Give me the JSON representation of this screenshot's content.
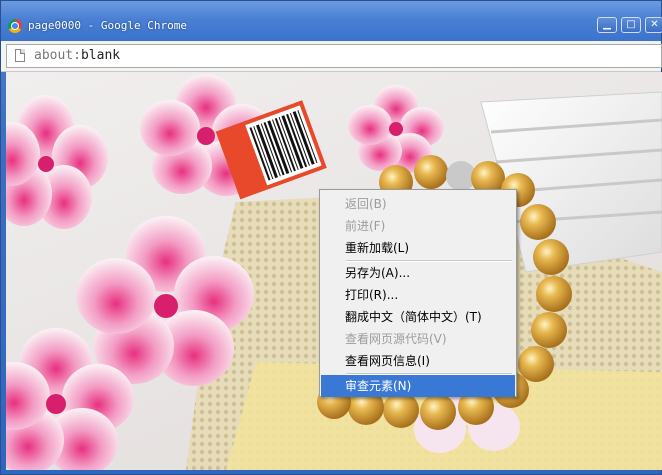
{
  "window": {
    "title": "page0000 - Google Chrome",
    "controls": {
      "minimize": "▁",
      "maximize": "□",
      "close": "✕"
    }
  },
  "omnibox": {
    "url_scheme": "about",
    "url_separator": ":",
    "url_path": "blank"
  },
  "context_menu": {
    "items": [
      {
        "label": "返回(B)",
        "enabled": false
      },
      {
        "label": "前进(F)",
        "enabled": false
      },
      {
        "label": "重新加载(L)",
        "enabled": true
      },
      {
        "label": "另存为(A)...",
        "enabled": true
      },
      {
        "label": "打印(R)...",
        "enabled": true
      },
      {
        "label": "翻成中文（简体中文）(T)",
        "enabled": true
      },
      {
        "label": "查看网页源代码(V)",
        "enabled": false
      },
      {
        "label": "查看网页信息(I)",
        "enabled": true
      },
      {
        "label": "审查元素(N)",
        "enabled": true,
        "highlighted": true
      }
    ]
  },
  "colors": {
    "title_bar": "#4a80d4",
    "menu_highlight": "#3a78d6",
    "disabled_text": "#9c9c9c",
    "price_tag": "#e8492a"
  }
}
